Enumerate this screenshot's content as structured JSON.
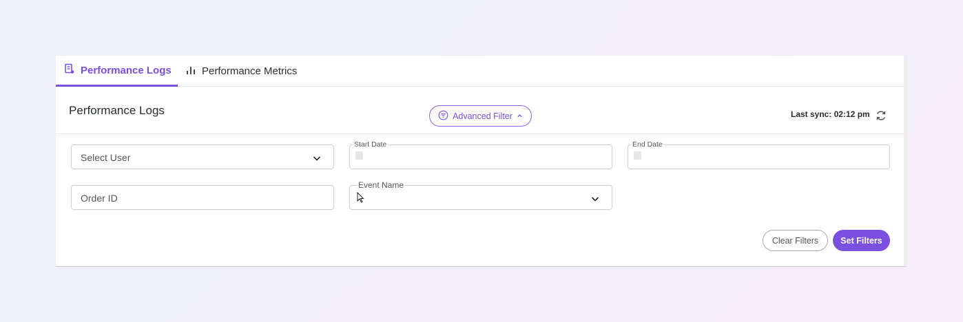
{
  "tabs": [
    {
      "label": "Performance Logs",
      "icon": "document-icon",
      "active": true
    },
    {
      "label": "Performance Metrics",
      "icon": "bar-chart-icon",
      "active": false
    }
  ],
  "header": {
    "title": "Performance Logs",
    "advanced_filter_label": "Advanced Filter",
    "sync_text": "Last sync: 02:12 pm"
  },
  "filters": {
    "select_user": {
      "placeholder": "Select User"
    },
    "start_date": {
      "label": "Start Date",
      "value": ""
    },
    "end_date": {
      "label": "End Date",
      "value": ""
    },
    "order_id": {
      "placeholder": "Order ID"
    },
    "event_name": {
      "label": "Event Name",
      "value": ""
    }
  },
  "actions": {
    "clear_label": "Clear Filters",
    "set_label": "Set Filters"
  },
  "colors": {
    "accent": "#7b4fe0",
    "border": "#cfcfd6"
  }
}
